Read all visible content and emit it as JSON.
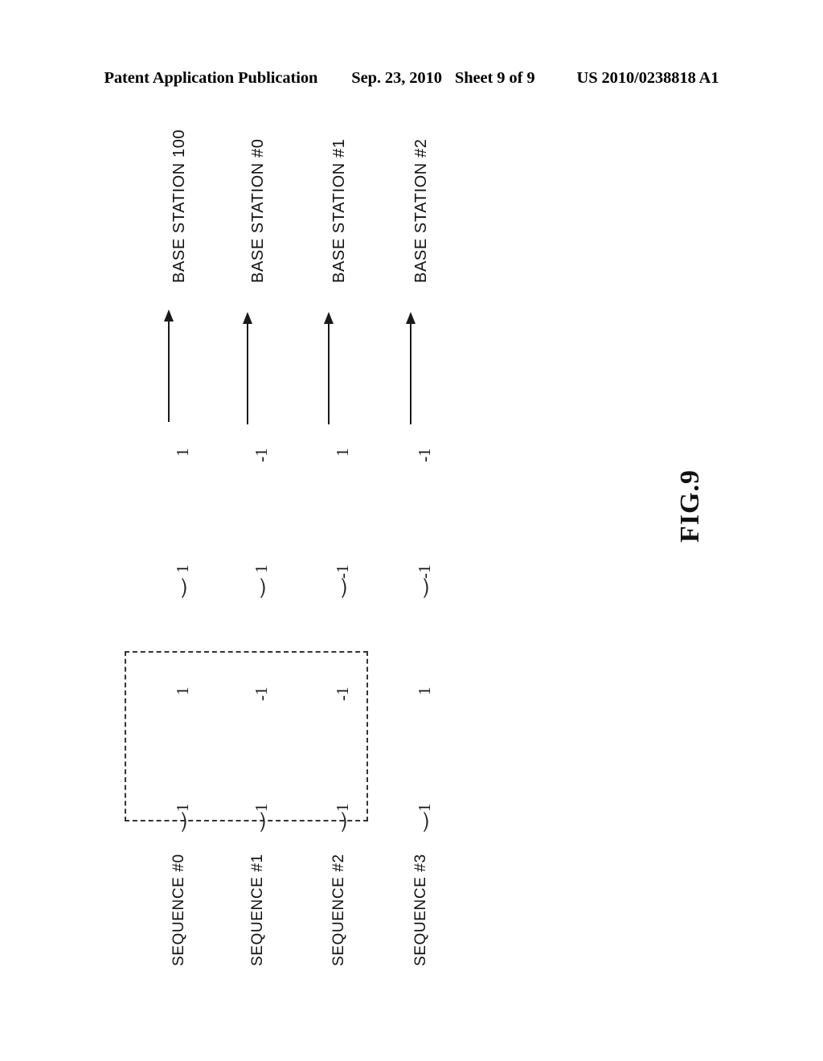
{
  "header": {
    "title": "Patent Application Publication",
    "date": "Sep. 23, 2010",
    "sheet": "Sheet 9 of 9",
    "publication_number": "US 2010/0238818 A1"
  },
  "figure": {
    "label": "FIG.9",
    "destinations": [
      {
        "id": "base-station-100",
        "label": "BASE STATION 100"
      },
      {
        "id": "base-station-0",
        "label": "BASE STATION #0"
      },
      {
        "id": "base-station-1",
        "label": "BASE STATION #1"
      },
      {
        "id": "base-station-2",
        "label": "BASE STATION #2"
      }
    ],
    "sequences": [
      {
        "id": "sequence-0",
        "label": "SEQUENCE #0",
        "values": [
          "1",
          "1",
          "1",
          "1"
        ]
      },
      {
        "id": "sequence-1",
        "label": "SEQUENCE #1",
        "values": [
          "1",
          "-1",
          "1",
          "-1"
        ]
      },
      {
        "id": "sequence-2",
        "label": "SEQUENCE #2",
        "values": [
          "1",
          "-1",
          "-1",
          "1"
        ]
      },
      {
        "id": "sequence-3",
        "label": "SEQUENCE #3",
        "values": [
          "1",
          "1",
          "-1",
          "-1"
        ]
      }
    ],
    "arrow_count": 4,
    "highlight_box": {
      "style": "dashed",
      "covers_columns": [
        0,
        1
      ]
    },
    "brace_glyph": "⏝",
    "colors": {
      "ink": "#111111",
      "dashed_border": "#333333"
    }
  }
}
